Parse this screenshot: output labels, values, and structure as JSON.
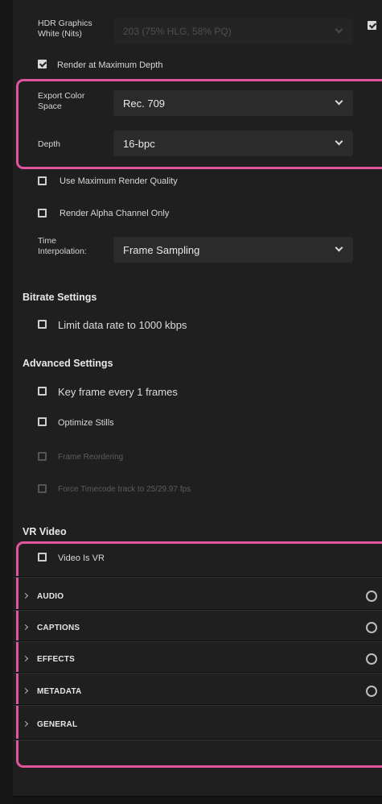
{
  "hdr": {
    "label": "HDR Graphics White (Nits)",
    "value": "203 (75% HLG, 58% PQ)"
  },
  "render_max_depth": {
    "label": "Render at Maximum Depth",
    "checked": true
  },
  "export_color_space": {
    "label": "Export Color Space",
    "value": "Rec. 709"
  },
  "depth": {
    "label": "Depth",
    "value": "16-bpc"
  },
  "use_max_render_quality": {
    "label": "Use Maximum Render Quality",
    "checked": false
  },
  "render_alpha_only": {
    "label": "Render Alpha Channel Only",
    "checked": false
  },
  "time_interpolation": {
    "label": "Time Interpolation:",
    "value": "Frame Sampling"
  },
  "bitrate": {
    "heading": "Bitrate Settings",
    "limit_rate": {
      "label": "Limit data rate to 1000 kbps",
      "checked": false
    }
  },
  "advanced": {
    "heading": "Advanced Settings",
    "key_frame": {
      "label": "Key frame every 1 frames",
      "checked": false
    },
    "optimize_stills": {
      "label": "Optimize Stills",
      "checked": false
    },
    "frame_reordering": {
      "label": "Frame Reordering",
      "checked": false,
      "disabled": true
    },
    "force_timecode": {
      "label": "Force Timecode track to 25/29.97 fps",
      "checked": false,
      "disabled": true
    }
  },
  "vr": {
    "heading": "VR Video",
    "video_is_vr": {
      "label": "Video Is VR",
      "checked": false
    }
  },
  "sections": [
    {
      "label": "AUDIO",
      "has_toggle": true
    },
    {
      "label": "CAPTIONS",
      "has_toggle": true
    },
    {
      "label": "EFFECTS",
      "has_toggle": true
    },
    {
      "label": "METADATA",
      "has_toggle": true
    },
    {
      "label": "GENERAL",
      "has_toggle": false
    }
  ],
  "colors": {
    "highlight": "#e0559e",
    "panel": "#1f1f1f",
    "field": "#2b2b2b"
  }
}
